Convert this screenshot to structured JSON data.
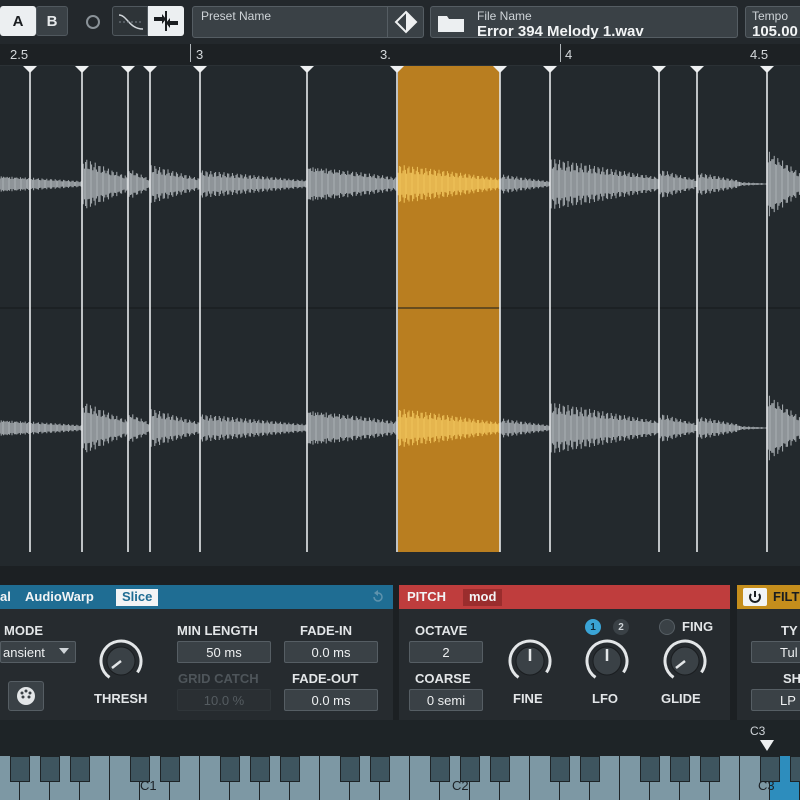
{
  "header": {
    "ab_a": "A",
    "ab_b": "B",
    "preset_label": "Preset Name",
    "file_label": "File Name",
    "file_value": "Error 394 Melody 1.wav",
    "tempo_label": "Tempo",
    "tempo_value": "105.00"
  },
  "ruler": {
    "labels": [
      "2.5",
      "3",
      "3.",
      "4",
      "4.5"
    ]
  },
  "slice_panel": {
    "tab_partial": "al",
    "tab_audiowarp": "AudioWarp",
    "tab_slice": "Slice",
    "mode_label": "MODE",
    "mode_value": "ansient",
    "thresh_label": "THRESH",
    "min_length_label": "MIN LENGTH",
    "min_length_value": "50 ms",
    "grid_catch_label": "GRID CATCH",
    "grid_catch_value": "10.0 %",
    "fade_in_label": "FADE-IN",
    "fade_in_value": "0.0 ms",
    "fade_out_label": "FADE-OUT",
    "fade_out_value": "0.0 ms"
  },
  "pitch_panel": {
    "title": "PITCH",
    "mod_tag": "mod",
    "octave_label": "OCTAVE",
    "octave_value": "2",
    "coarse_label": "COARSE",
    "coarse_value": "0 semi",
    "fine_label": "FINE",
    "lfo_label": "LFO",
    "lfo_radio_1": "1",
    "lfo_radio_2": "2",
    "fing_label": "FING",
    "glide_label": "GLIDE"
  },
  "filter_panel": {
    "title": "FILT",
    "type_label": "TY",
    "type_value": "Tul",
    "shape_label": "SH",
    "shape_value": "LP"
  },
  "keyboard": {
    "c3_marker": "C3",
    "key_labels": [
      "C1",
      "C2",
      "C3"
    ]
  },
  "colors": {
    "selection": "#c7861f",
    "slice_tab": "#1f6d93",
    "pitch_tab": "#bf3d3d",
    "filter_tab": "#c58e1c"
  }
}
